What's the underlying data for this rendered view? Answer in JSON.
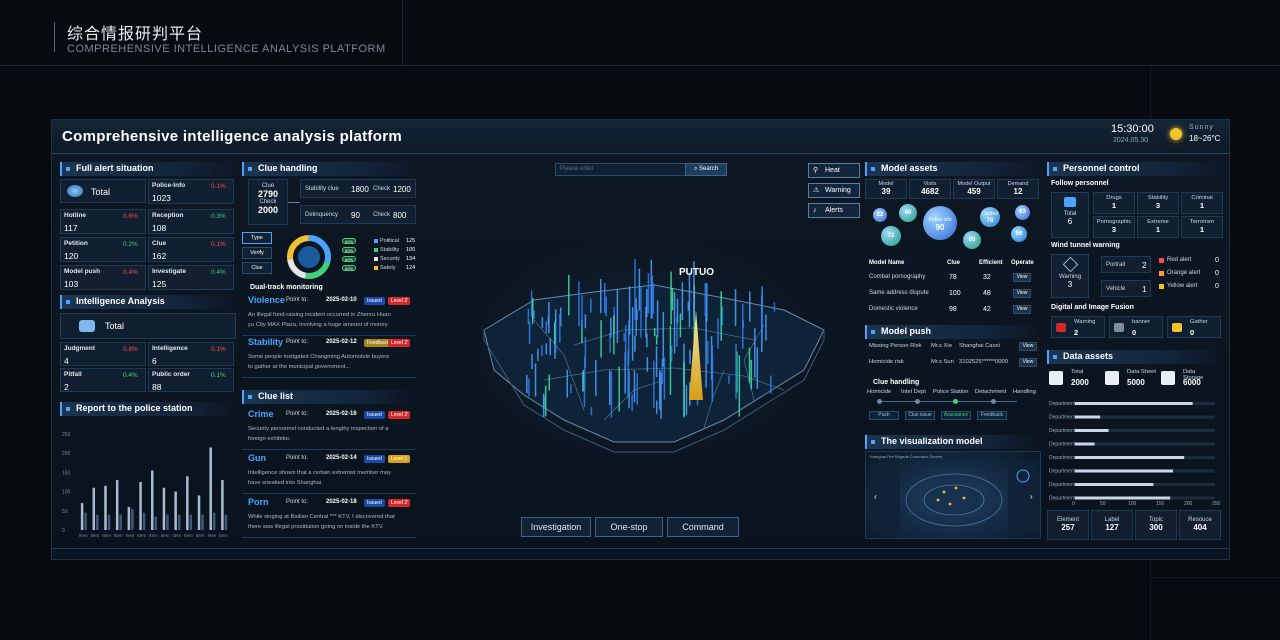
{
  "page": {
    "cn_title": "综合情报研判平台",
    "en_title": "COMPREHENSIVE INTELLIGENCE ANALYSIS PLATFORM"
  },
  "header": {
    "title": "Comprehensive intelligence analysis platform",
    "time": "15:30:00",
    "date": "2024.05.30",
    "weather": "Sunny",
    "temp": "18~26°C"
  },
  "alert": {
    "title": "Full alert situation",
    "total": "Total",
    "items": [
      {
        "label": "Police-Info",
        "value": "1023",
        "pct": "0.1%",
        "color": "red"
      },
      {
        "label": "Hotline",
        "value": "117",
        "pct": "0.6%",
        "color": "red"
      },
      {
        "label": "Reception",
        "value": "108",
        "pct": "0.3%",
        "color": "green"
      },
      {
        "label": "Petition",
        "value": "120",
        "pct": "0.2%",
        "color": "green"
      },
      {
        "label": "Clue",
        "value": "162",
        "pct": "0.1%",
        "color": "red"
      },
      {
        "label": "Model push",
        "value": "103",
        "pct": "0.4%",
        "color": "red"
      },
      {
        "label": "Investigate",
        "value": "125",
        "pct": "0.4%",
        "color": "green"
      }
    ]
  },
  "intel": {
    "title": "Intelligence Analysis",
    "total": "Total",
    "items": [
      {
        "label": "Judgment",
        "value": "4",
        "pct": "0.8%",
        "color": "red"
      },
      {
        "label": "Intelligence",
        "value": "6",
        "pct": "0.1%",
        "color": "red"
      },
      {
        "label": "Pitfall",
        "value": "2",
        "pct": "0.4%",
        "color": "green"
      },
      {
        "label": "Public order",
        "value": "88",
        "pct": "0.1%",
        "color": "green"
      }
    ]
  },
  "report": {
    "title": "Report to the police station",
    "yticks": [
      "250",
      "200",
      "150",
      "100",
      "50",
      "0"
    ],
    "xlabel": "Item"
  },
  "chart_data": {
    "type": "bar",
    "title": "Report to the police station",
    "ylim": [
      0,
      250
    ],
    "categories": [
      "Item",
      "Item",
      "Item",
      "Item",
      "Item",
      "Item",
      "Item",
      "Item",
      "Item",
      "Item",
      "Item",
      "Item",
      "Item"
    ],
    "series": [
      {
        "values": [
          70,
          110,
          115,
          130,
          60,
          125,
          155,
          110,
          100,
          140,
          90,
          215,
          130
        ]
      },
      {
        "values": [
          45,
          40,
          40,
          40,
          55,
          45,
          35,
          40,
          40,
          40,
          40,
          45,
          40
        ]
      }
    ]
  },
  "clue": {
    "title": "Clue handling",
    "clue_label": "Clue",
    "clue_val": "2790",
    "check_label": "Check",
    "check_val": "2000",
    "stability": {
      "label": "Stability clue",
      "a": "1800",
      "check": "Check",
      "b": "1200"
    },
    "delinquency": {
      "label": "Delinquency",
      "a": "90",
      "check": "Check",
      "b": "800"
    },
    "tabs": [
      "Type",
      "Verify",
      "Clue"
    ],
    "legend": [
      {
        "label": "Political",
        "value": "125",
        "color": "#4aa3ff"
      },
      {
        "label": "Stability",
        "value": "100",
        "color": "#3fd17c"
      },
      {
        "label": "Security",
        "value": "134",
        "color": "#e6e6e6"
      },
      {
        "label": "Safety",
        "value": "124",
        "color": "#f3c12c"
      }
    ],
    "pills": [
      "60%",
      "60%",
      "60%",
      "60%"
    ],
    "dual": "Dual-track monitoring",
    "tracks": [
      {
        "title": "Violence",
        "point": "Point to:",
        "date": "2025-02-10",
        "status": "Issued",
        "level": "Level 2",
        "text1": "An illegal fund-raising incident occurred in Zhenru Huan",
        "text2": "yu City MAX Plaza, involving a huge amount of money."
      },
      {
        "title": "Stability",
        "point": "Point to:",
        "date": "2025-02-12",
        "status": "Feedback",
        "level": "Level 2",
        "text1": "Some people instigated Changming Automobile buyers",
        "text2": "to gather at the municipal government..."
      }
    ]
  },
  "cluelist": {
    "title": "Clue list",
    "items": [
      {
        "title": "Crime",
        "point": "Point to:",
        "date": "2025-02-16",
        "status": "Issued",
        "level": "Level 2",
        "text1": "Security personnel conducted a lengthy inspection of a",
        "text2": "foreign exhibitor."
      },
      {
        "title": "Gun",
        "point": "Point to:",
        "date": "2025-02-14",
        "status": "Issued",
        "level": "Level 3",
        "text1": "Intelligence shows that a certain extremist member may",
        "text2": "have sneaked into Shanghai."
      },
      {
        "title": "Porn",
        "point": "Point to:",
        "date": "2025-02-18",
        "status": "Issued",
        "level": "Level 2",
        "text1": "While singing at Bailian Central *** KTV, I discovered that",
        "text2": "there was illegal prostitution going on inside the KTV."
      }
    ]
  },
  "center": {
    "search_placeholder": "Please enter",
    "search_btn": "Search",
    "map_label": "PUTUO",
    "tools": [
      "Heat",
      "Warning",
      "Alerts"
    ],
    "buttons": [
      "Investigation",
      "One-stop",
      "Command"
    ]
  },
  "model": {
    "title": "Model assets",
    "stats": [
      {
        "label": "Model",
        "value": "39"
      },
      {
        "label": "Visits",
        "value": "4682"
      },
      {
        "label": "Model Output",
        "value": "459"
      },
      {
        "label": "Demand",
        "value": "12"
      }
    ],
    "bubbles": [
      {
        "t": "",
        "v": "22"
      },
      {
        "t": "",
        "v": "40"
      },
      {
        "t": "Police info",
        "v": "90"
      },
      {
        "t": "Control",
        "v": "78"
      },
      {
        "t": "",
        "v": "63"
      },
      {
        "t": "",
        "v": "72"
      },
      {
        "t": "",
        "v": "65"
      },
      {
        "t": "",
        "v": "59"
      }
    ],
    "cols": [
      "Model Name",
      "Clue",
      "Efficient",
      "Operate"
    ],
    "rows": [
      {
        "name": "Combat pornography",
        "clue": "78",
        "eff": "32",
        "op": "View"
      },
      {
        "name": "Same address dispute",
        "clue": "100",
        "eff": "48",
        "op": "View"
      },
      {
        "name": "Domestic violence",
        "clue": "98",
        "eff": "42",
        "op": "View"
      }
    ]
  },
  "push": {
    "title": "Model push",
    "rows": [
      {
        "a": "Missing Person Risk",
        "b": "Mr.s Xie",
        "c": "Shanghai Caoxi",
        "op": "View"
      },
      {
        "a": "Homicide risk",
        "b": "Mr.s Sun",
        "c": "3102525******0000",
        "op": "View"
      }
    ],
    "handling": "Clue handling",
    "steps": [
      "Homicide",
      "Intel Dept",
      "Police Station",
      "Detachment",
      "Handling"
    ],
    "chips": [
      "Push",
      "Clue issue",
      "Assistance",
      "Feedback"
    ]
  },
  "vis": {
    "title": "The visualization model",
    "caption": "Shanghai Fire Brigade Command Screen"
  },
  "personnel": {
    "title": "Personnel control",
    "follow": "Follow personnel",
    "total_label": "Total",
    "total": "6",
    "cats": [
      {
        "label": "Drugs",
        "value": "1"
      },
      {
        "label": "Stability",
        "value": "3"
      },
      {
        "label": "Criminal",
        "value": "1"
      },
      {
        "label": "Pornographic",
        "value": "3"
      },
      {
        "label": "Extreme",
        "value": "1"
      },
      {
        "label": "Terrorism",
        "value": "1"
      }
    ],
    "wind": "Wind tunnel warning",
    "warn_label": "Warning",
    "warn": "3",
    "portrait": "Portrait",
    "portrait_v": "2",
    "vehicle": "Vehicle",
    "vehicle_v": "1",
    "alerts": [
      {
        "label": "Red alert",
        "value": "0",
        "color": "#ff4d4f"
      },
      {
        "label": "Orange alert",
        "value": "0",
        "color": "#ff9a2e"
      },
      {
        "label": "Yellow alert",
        "value": "0",
        "color": "#f3c12c"
      }
    ],
    "fusion": "Digital and Image Fusion",
    "fusion_items": [
      {
        "label": "Warning",
        "value": "2"
      },
      {
        "label": "banner",
        "value": "0"
      },
      {
        "label": "Gather",
        "value": "0"
      }
    ]
  },
  "assets": {
    "title": "Data assets",
    "stats": [
      {
        "label": "Total",
        "value": "2000"
      },
      {
        "label": "Data Sheet",
        "value": "5000"
      },
      {
        "label": "Data Storage",
        "value": "6000"
      }
    ],
    "bars": [
      {
        "label": "Department",
        "v": 210
      },
      {
        "label": "Department",
        "v": 45
      },
      {
        "label": "Department",
        "v": 60
      },
      {
        "label": "Department",
        "v": 35
      },
      {
        "label": "Department",
        "v": 195
      },
      {
        "label": "Department",
        "v": 175
      },
      {
        "label": "Department",
        "v": 140
      },
      {
        "label": "Department",
        "v": 170
      }
    ],
    "xticks": [
      "0",
      "50",
      "100",
      "150",
      "200",
      "250"
    ],
    "bottom": [
      {
        "label": "Element",
        "value": "257"
      },
      {
        "label": "Label",
        "value": "127"
      },
      {
        "label": "Topic",
        "value": "300"
      },
      {
        "label": "Resouce",
        "value": "404"
      }
    ]
  }
}
